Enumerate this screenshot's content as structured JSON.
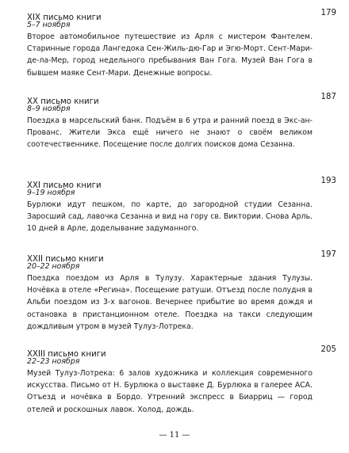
{
  "letters": [
    {
      "title": "XIX письмо книги",
      "page": "179",
      "date": "5–7 ноября",
      "text": "Второе автомобильное путешествие из Арля с мистером Фантелем. Старинные города Лангедока Сен-Жиль-дю-Гар и Эгю-Морт. Сент-Мари-де-ла-Мер, город недельного пребывания Ван Гога. Музей Ван Гога в бывшем маяке Сент-Мари. Денежные вопросы."
    },
    {
      "title": "XX письмо книги",
      "page": "187",
      "date": "8–9 ноября",
      "text": "Поездка в марсельский банк. Подъём в 6 утра и ранний поезд в Экс-ан-Прованс. Жители Экса ещё ничего не знают о своём великом соотечественнике. Посещение после долгих поисков дома Сезанна."
    },
    {
      "title": "XXI письмо книги",
      "page": "193",
      "date": "9–19 ноября",
      "text": "Бурлюки идут пешком, по карте, до загородной студии Сезанна. Заросший сад, лавочка Сезанна и вид на гору св. Виктории. Снова Арль. 10 дней в Арле, доделывание задуманного."
    },
    {
      "title": "XXII письмо книги",
      "page": "197",
      "date": "20–22 ноября",
      "text": "Поездка поездом из Арля в Тулузу. Характерные здания Тулузы. Ночёвка в отеле «Регина». Посещение ратуши. Отъезд после полудня в Альби поездом из 3-х вагонов. Вечернее прибытие во время дождя и остановка в пристанционном отеле. Поездка на такси следующим дождливым утром в музей Тулуз-Лотрека."
    },
    {
      "title": "XXIII письмо книги",
      "page": "205",
      "date": "22–23 ноября",
      "text": "Музей Тулуз-Лотрека: 6 залов художника и коллекция современного искусства. Письмо от Н. Бурлюка о выставке Д. Бурлюка в галерее АСА. Отъезд и ночёвка в Бордо. Утренний экспресс в Биарриц — город отелей и роскошных лавок. Холод, дождь."
    }
  ],
  "footer": {
    "page_number": "— 11 —"
  }
}
